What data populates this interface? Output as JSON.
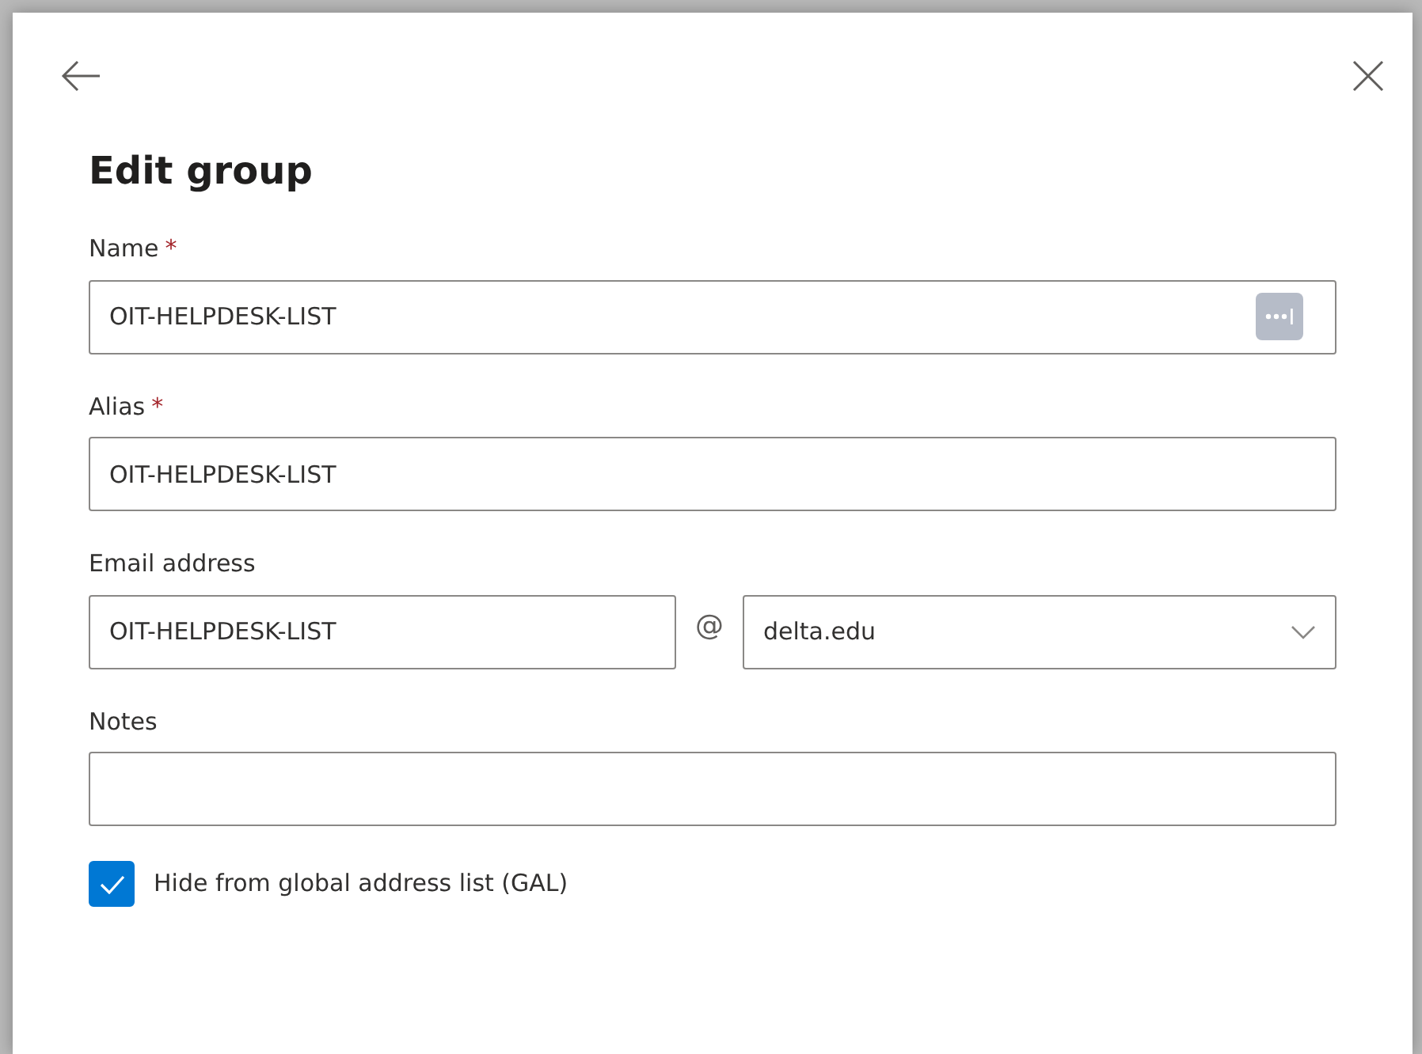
{
  "panel": {
    "title": "Edit group"
  },
  "fields": [
    {
      "kind": "text_with_menu",
      "label": "Name",
      "required_mark": "*",
      "value": "OIT-HELPDESK-LIST"
    },
    {
      "kind": "text",
      "label": "Alias",
      "required_mark": "*",
      "value": "OIT-HELPDESK-LIST"
    },
    {
      "kind": "email",
      "label": "Email address",
      "value": "OIT-HELPDESK-LIST",
      "separator": "@",
      "domain": "delta.edu"
    },
    {
      "kind": "text",
      "label": "Notes"
    }
  ],
  "checkbox": {
    "label": "Hide from global address list (GAL)",
    "checked": true
  }
}
